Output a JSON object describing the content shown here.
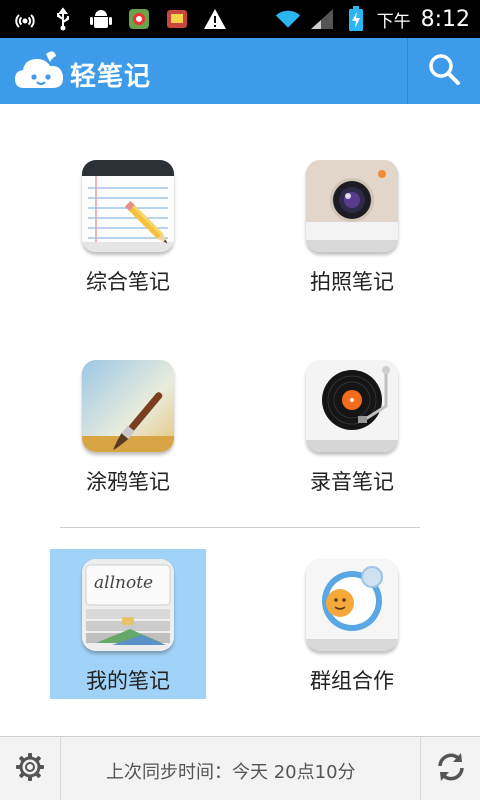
{
  "status_bar": {
    "ampm": "下午",
    "time": "8:12"
  },
  "app_bar": {
    "title": "轻笔记"
  },
  "tiles": [
    {
      "label": "综合笔记"
    },
    {
      "label": "拍照笔记"
    },
    {
      "label": "涂鸦笔记"
    },
    {
      "label": "录音笔记"
    },
    {
      "label": "我的笔记"
    },
    {
      "label": "群组合作"
    }
  ],
  "my_notes_cover_text": "allnote",
  "bottom_bar": {
    "sync_text": "上次同步时间：今天 20点10分"
  },
  "colors": {
    "app_bar": "#3d9be9",
    "selected_tile": "#a1d3f8",
    "record_label": "#f36b1c"
  }
}
